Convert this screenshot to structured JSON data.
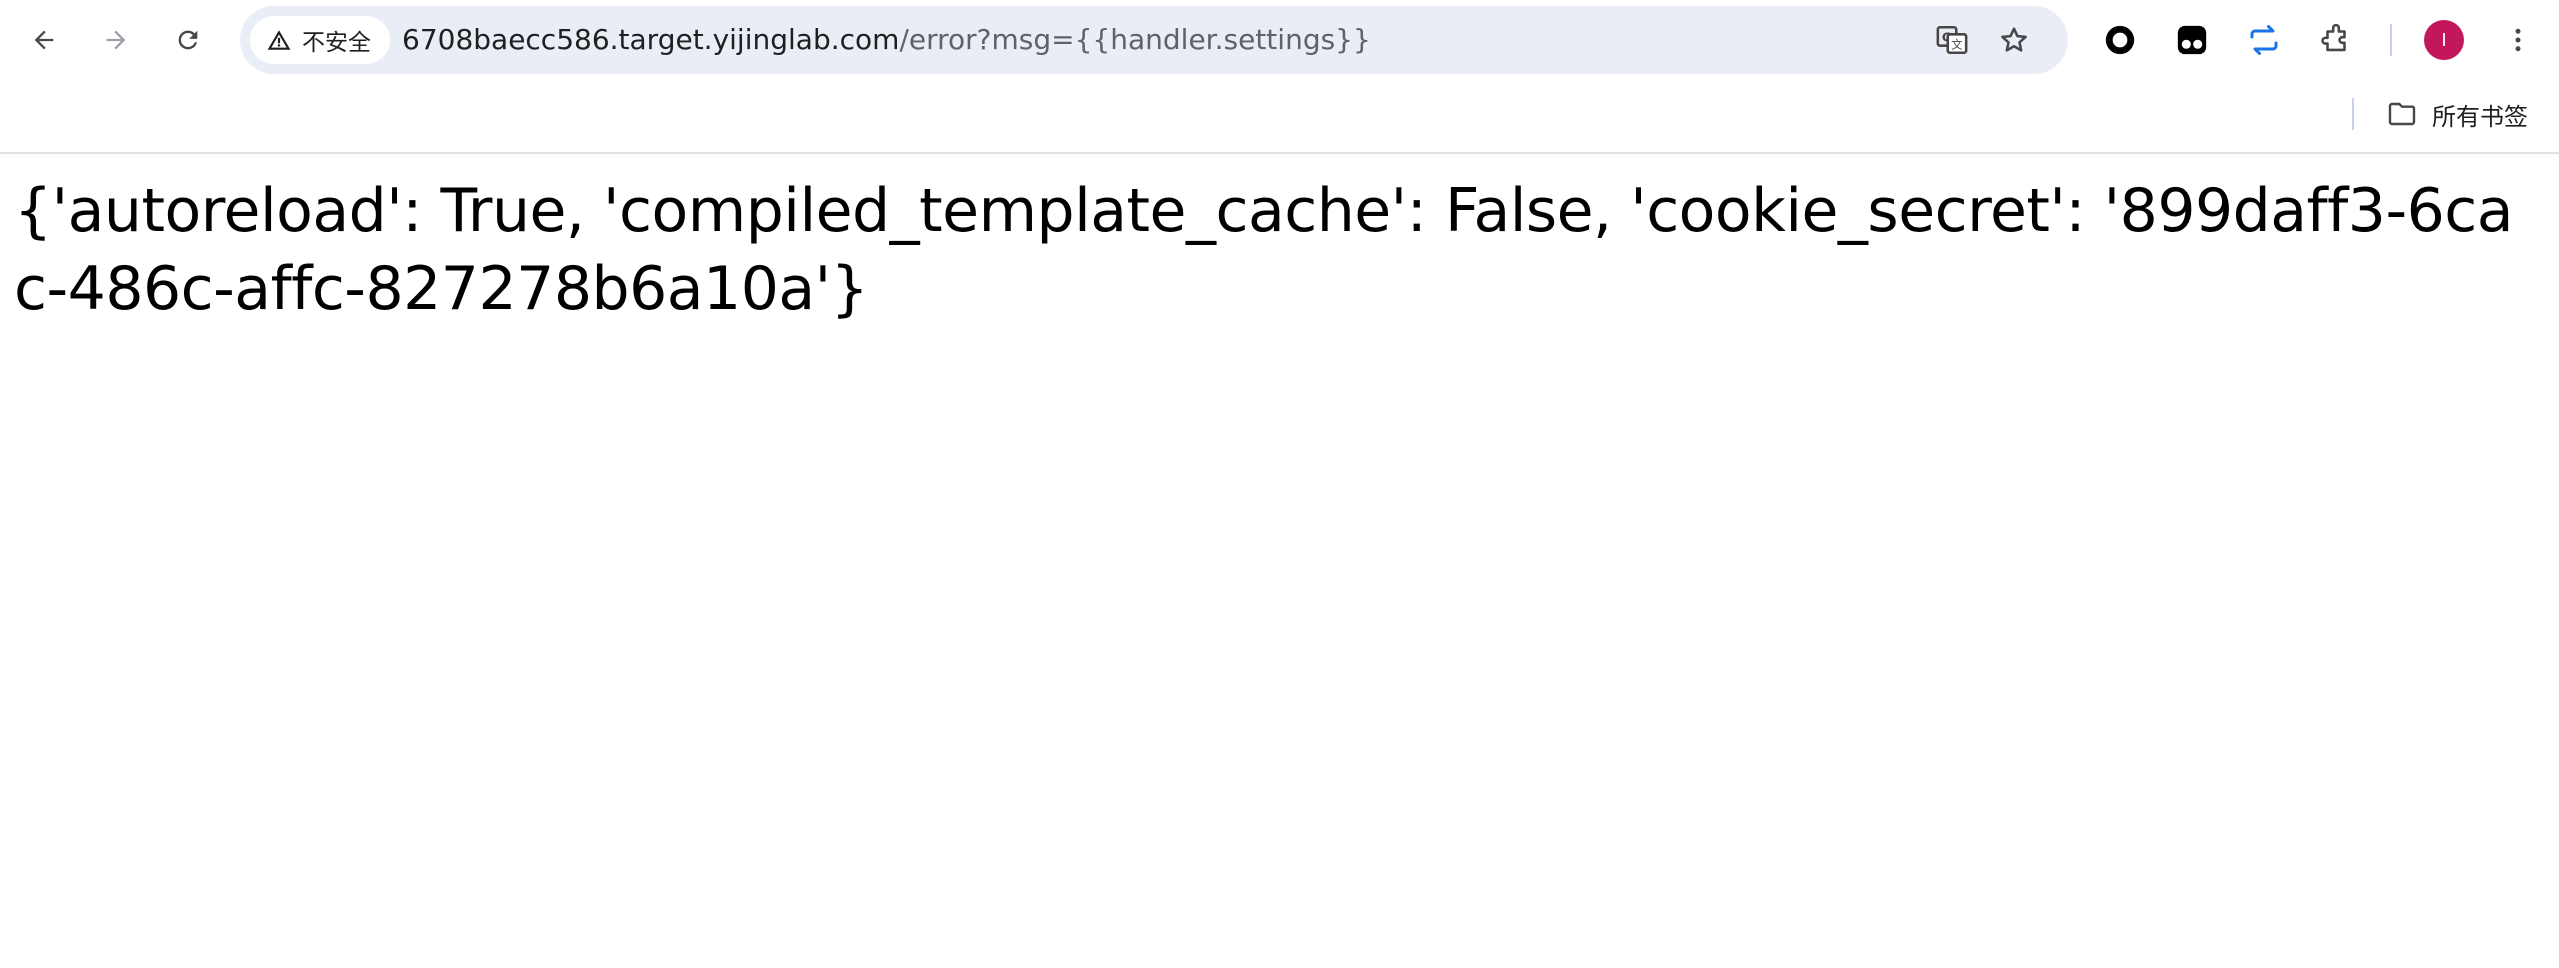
{
  "toolbar": {
    "security_label": "不安全",
    "url_host": "6708baecc586.target.yijinglab.com",
    "url_path": "/error?msg={{handler.settings}}",
    "avatar_initial": "I"
  },
  "bookmarks": {
    "all_bookmarks_label": "所有书签"
  },
  "page": {
    "body_text": "{'autoreload': True, 'compiled_template_cache': False, 'cookie_secret': '899daff3-6cac-486c-affc-827278b6a10a'}"
  },
  "colors": {
    "avatar": "#c2185b",
    "omnibox_bg": "#e9edf6",
    "sync_icon": "#1a73e8"
  },
  "icons": {
    "back": "arrow-left-icon",
    "forward": "arrow-right-icon",
    "reload": "reload-icon",
    "security": "warning-triangle-icon",
    "translate": "translate-icon",
    "bookmark": "star-icon",
    "extension1": "circle-extension-icon",
    "extension2": "tampermonkey-icon",
    "extension3": "sync-icon",
    "extensions": "puzzle-icon",
    "menu": "kebab-menu-icon",
    "folder": "folder-icon"
  }
}
